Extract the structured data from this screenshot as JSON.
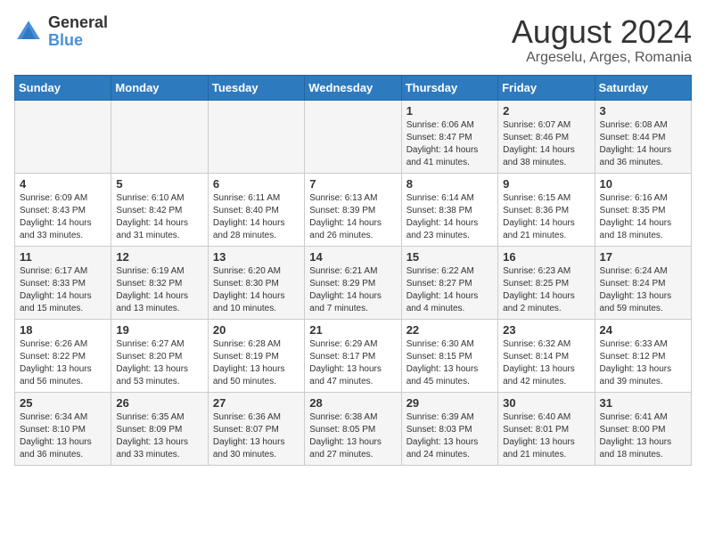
{
  "header": {
    "logo_general": "General",
    "logo_blue": "Blue",
    "month_year": "August 2024",
    "location": "Argeselu, Arges, Romania"
  },
  "weekdays": [
    "Sunday",
    "Monday",
    "Tuesday",
    "Wednesday",
    "Thursday",
    "Friday",
    "Saturday"
  ],
  "weeks": [
    [
      {
        "day": "",
        "info": ""
      },
      {
        "day": "",
        "info": ""
      },
      {
        "day": "",
        "info": ""
      },
      {
        "day": "",
        "info": ""
      },
      {
        "day": "1",
        "info": "Sunrise: 6:06 AM\nSunset: 8:47 PM\nDaylight: 14 hours\nand 41 minutes."
      },
      {
        "day": "2",
        "info": "Sunrise: 6:07 AM\nSunset: 8:46 PM\nDaylight: 14 hours\nand 38 minutes."
      },
      {
        "day": "3",
        "info": "Sunrise: 6:08 AM\nSunset: 8:44 PM\nDaylight: 14 hours\nand 36 minutes."
      }
    ],
    [
      {
        "day": "4",
        "info": "Sunrise: 6:09 AM\nSunset: 8:43 PM\nDaylight: 14 hours\nand 33 minutes."
      },
      {
        "day": "5",
        "info": "Sunrise: 6:10 AM\nSunset: 8:42 PM\nDaylight: 14 hours\nand 31 minutes."
      },
      {
        "day": "6",
        "info": "Sunrise: 6:11 AM\nSunset: 8:40 PM\nDaylight: 14 hours\nand 28 minutes."
      },
      {
        "day": "7",
        "info": "Sunrise: 6:13 AM\nSunset: 8:39 PM\nDaylight: 14 hours\nand 26 minutes."
      },
      {
        "day": "8",
        "info": "Sunrise: 6:14 AM\nSunset: 8:38 PM\nDaylight: 14 hours\nand 23 minutes."
      },
      {
        "day": "9",
        "info": "Sunrise: 6:15 AM\nSunset: 8:36 PM\nDaylight: 14 hours\nand 21 minutes."
      },
      {
        "day": "10",
        "info": "Sunrise: 6:16 AM\nSunset: 8:35 PM\nDaylight: 14 hours\nand 18 minutes."
      }
    ],
    [
      {
        "day": "11",
        "info": "Sunrise: 6:17 AM\nSunset: 8:33 PM\nDaylight: 14 hours\nand 15 minutes."
      },
      {
        "day": "12",
        "info": "Sunrise: 6:19 AM\nSunset: 8:32 PM\nDaylight: 14 hours\nand 13 minutes."
      },
      {
        "day": "13",
        "info": "Sunrise: 6:20 AM\nSunset: 8:30 PM\nDaylight: 14 hours\nand 10 minutes."
      },
      {
        "day": "14",
        "info": "Sunrise: 6:21 AM\nSunset: 8:29 PM\nDaylight: 14 hours\nand 7 minutes."
      },
      {
        "day": "15",
        "info": "Sunrise: 6:22 AM\nSunset: 8:27 PM\nDaylight: 14 hours\nand 4 minutes."
      },
      {
        "day": "16",
        "info": "Sunrise: 6:23 AM\nSunset: 8:25 PM\nDaylight: 14 hours\nand 2 minutes."
      },
      {
        "day": "17",
        "info": "Sunrise: 6:24 AM\nSunset: 8:24 PM\nDaylight: 13 hours\nand 59 minutes."
      }
    ],
    [
      {
        "day": "18",
        "info": "Sunrise: 6:26 AM\nSunset: 8:22 PM\nDaylight: 13 hours\nand 56 minutes."
      },
      {
        "day": "19",
        "info": "Sunrise: 6:27 AM\nSunset: 8:20 PM\nDaylight: 13 hours\nand 53 minutes."
      },
      {
        "day": "20",
        "info": "Sunrise: 6:28 AM\nSunset: 8:19 PM\nDaylight: 13 hours\nand 50 minutes."
      },
      {
        "day": "21",
        "info": "Sunrise: 6:29 AM\nSunset: 8:17 PM\nDaylight: 13 hours\nand 47 minutes."
      },
      {
        "day": "22",
        "info": "Sunrise: 6:30 AM\nSunset: 8:15 PM\nDaylight: 13 hours\nand 45 minutes."
      },
      {
        "day": "23",
        "info": "Sunrise: 6:32 AM\nSunset: 8:14 PM\nDaylight: 13 hours\nand 42 minutes."
      },
      {
        "day": "24",
        "info": "Sunrise: 6:33 AM\nSunset: 8:12 PM\nDaylight: 13 hours\nand 39 minutes."
      }
    ],
    [
      {
        "day": "25",
        "info": "Sunrise: 6:34 AM\nSunset: 8:10 PM\nDaylight: 13 hours\nand 36 minutes."
      },
      {
        "day": "26",
        "info": "Sunrise: 6:35 AM\nSunset: 8:09 PM\nDaylight: 13 hours\nand 33 minutes."
      },
      {
        "day": "27",
        "info": "Sunrise: 6:36 AM\nSunset: 8:07 PM\nDaylight: 13 hours\nand 30 minutes."
      },
      {
        "day": "28",
        "info": "Sunrise: 6:38 AM\nSunset: 8:05 PM\nDaylight: 13 hours\nand 27 minutes."
      },
      {
        "day": "29",
        "info": "Sunrise: 6:39 AM\nSunset: 8:03 PM\nDaylight: 13 hours\nand 24 minutes."
      },
      {
        "day": "30",
        "info": "Sunrise: 6:40 AM\nSunset: 8:01 PM\nDaylight: 13 hours\nand 21 minutes."
      },
      {
        "day": "31",
        "info": "Sunrise: 6:41 AM\nSunset: 8:00 PM\nDaylight: 13 hours\nand 18 minutes."
      }
    ]
  ]
}
